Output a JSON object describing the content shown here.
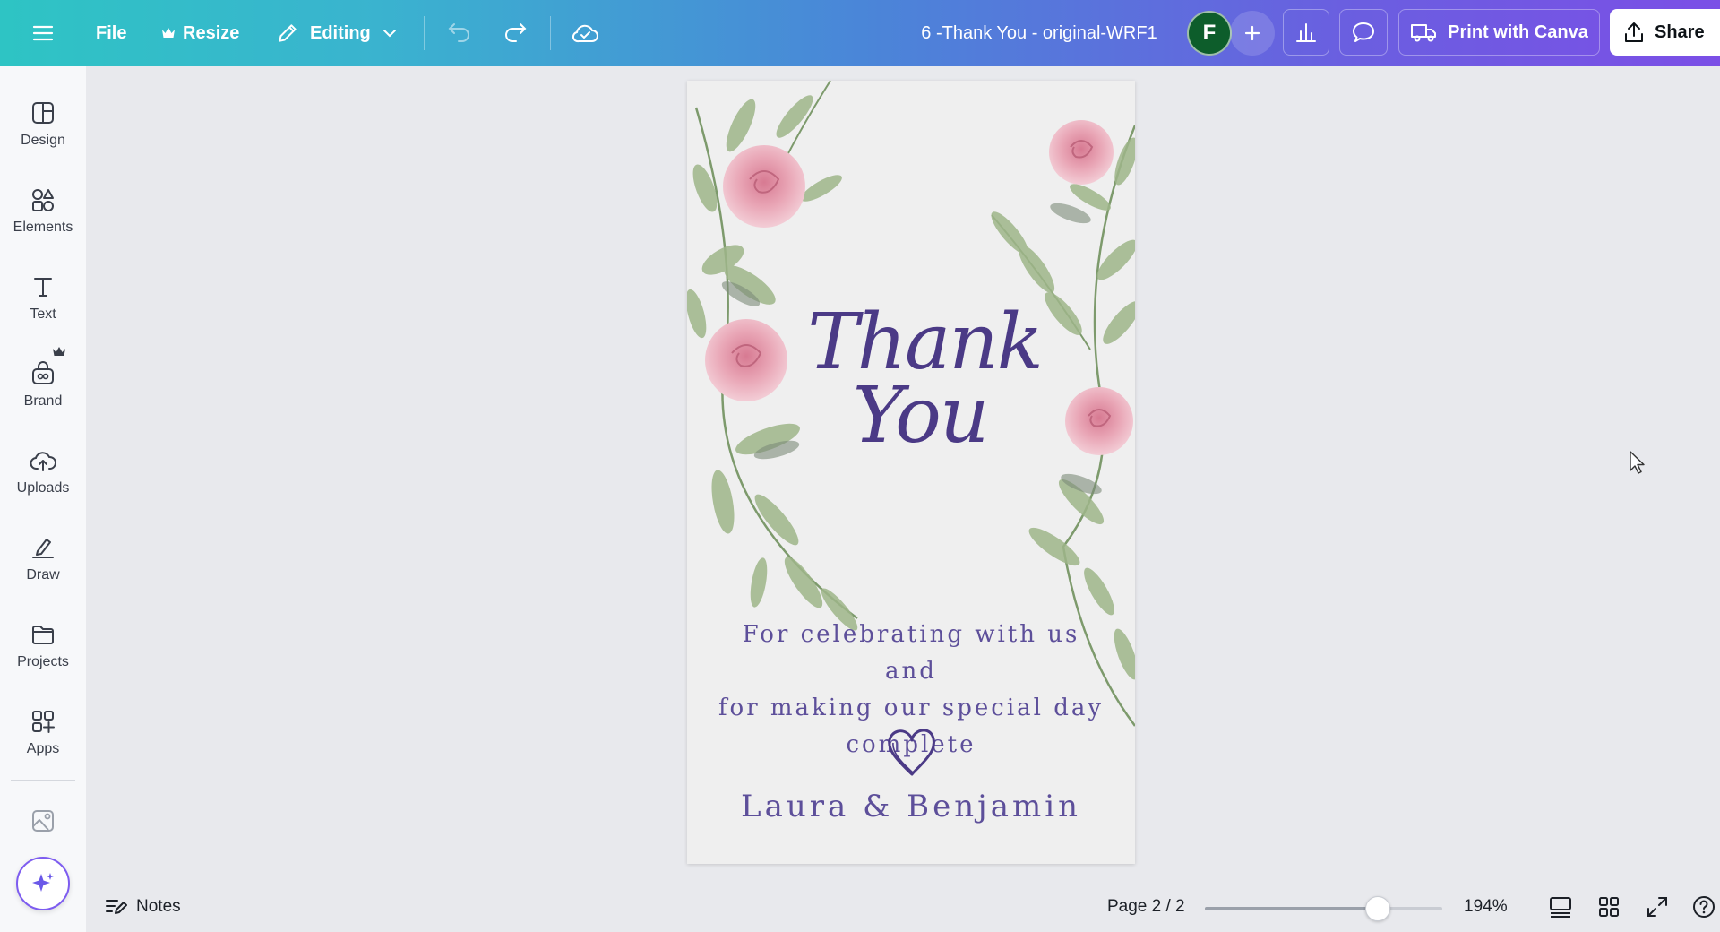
{
  "topbar": {
    "file_label": "File",
    "resize_label": "Resize",
    "editing_label": "Editing",
    "doc_title": "6 -Thank You - original-WRF1",
    "avatar_initial": "F",
    "print_label": "Print with Canva",
    "share_label": "Share"
  },
  "sidebar": {
    "items": [
      {
        "label": "Design",
        "icon": "design-icon"
      },
      {
        "label": "Elements",
        "icon": "elements-icon"
      },
      {
        "label": "Text",
        "icon": "text-icon"
      },
      {
        "label": "Brand",
        "icon": "brand-icon"
      },
      {
        "label": "Uploads",
        "icon": "uploads-icon"
      },
      {
        "label": "Draw",
        "icon": "draw-icon"
      },
      {
        "label": "Projects",
        "icon": "projects-icon"
      },
      {
        "label": "Apps",
        "icon": "apps-icon"
      }
    ]
  },
  "canvas": {
    "thank_line1": "Thank",
    "thank_line2": "You",
    "message_line1": "For celebrating with us and",
    "message_line2": "for making our special day",
    "message_line3": "complete",
    "names": "Laura & Benjamin"
  },
  "bottombar": {
    "notes_label": "Notes",
    "page_indicator": "Page 2 / 2",
    "zoom_value": "194%",
    "zoom_fraction": 0.73
  },
  "colors": {
    "gradient_start": "#2ec4c4",
    "gradient_end": "#7b4fe6",
    "avatar_bg": "#0d5d2b",
    "script_text": "#4b3a86",
    "body_text": "#5d4f9a"
  }
}
